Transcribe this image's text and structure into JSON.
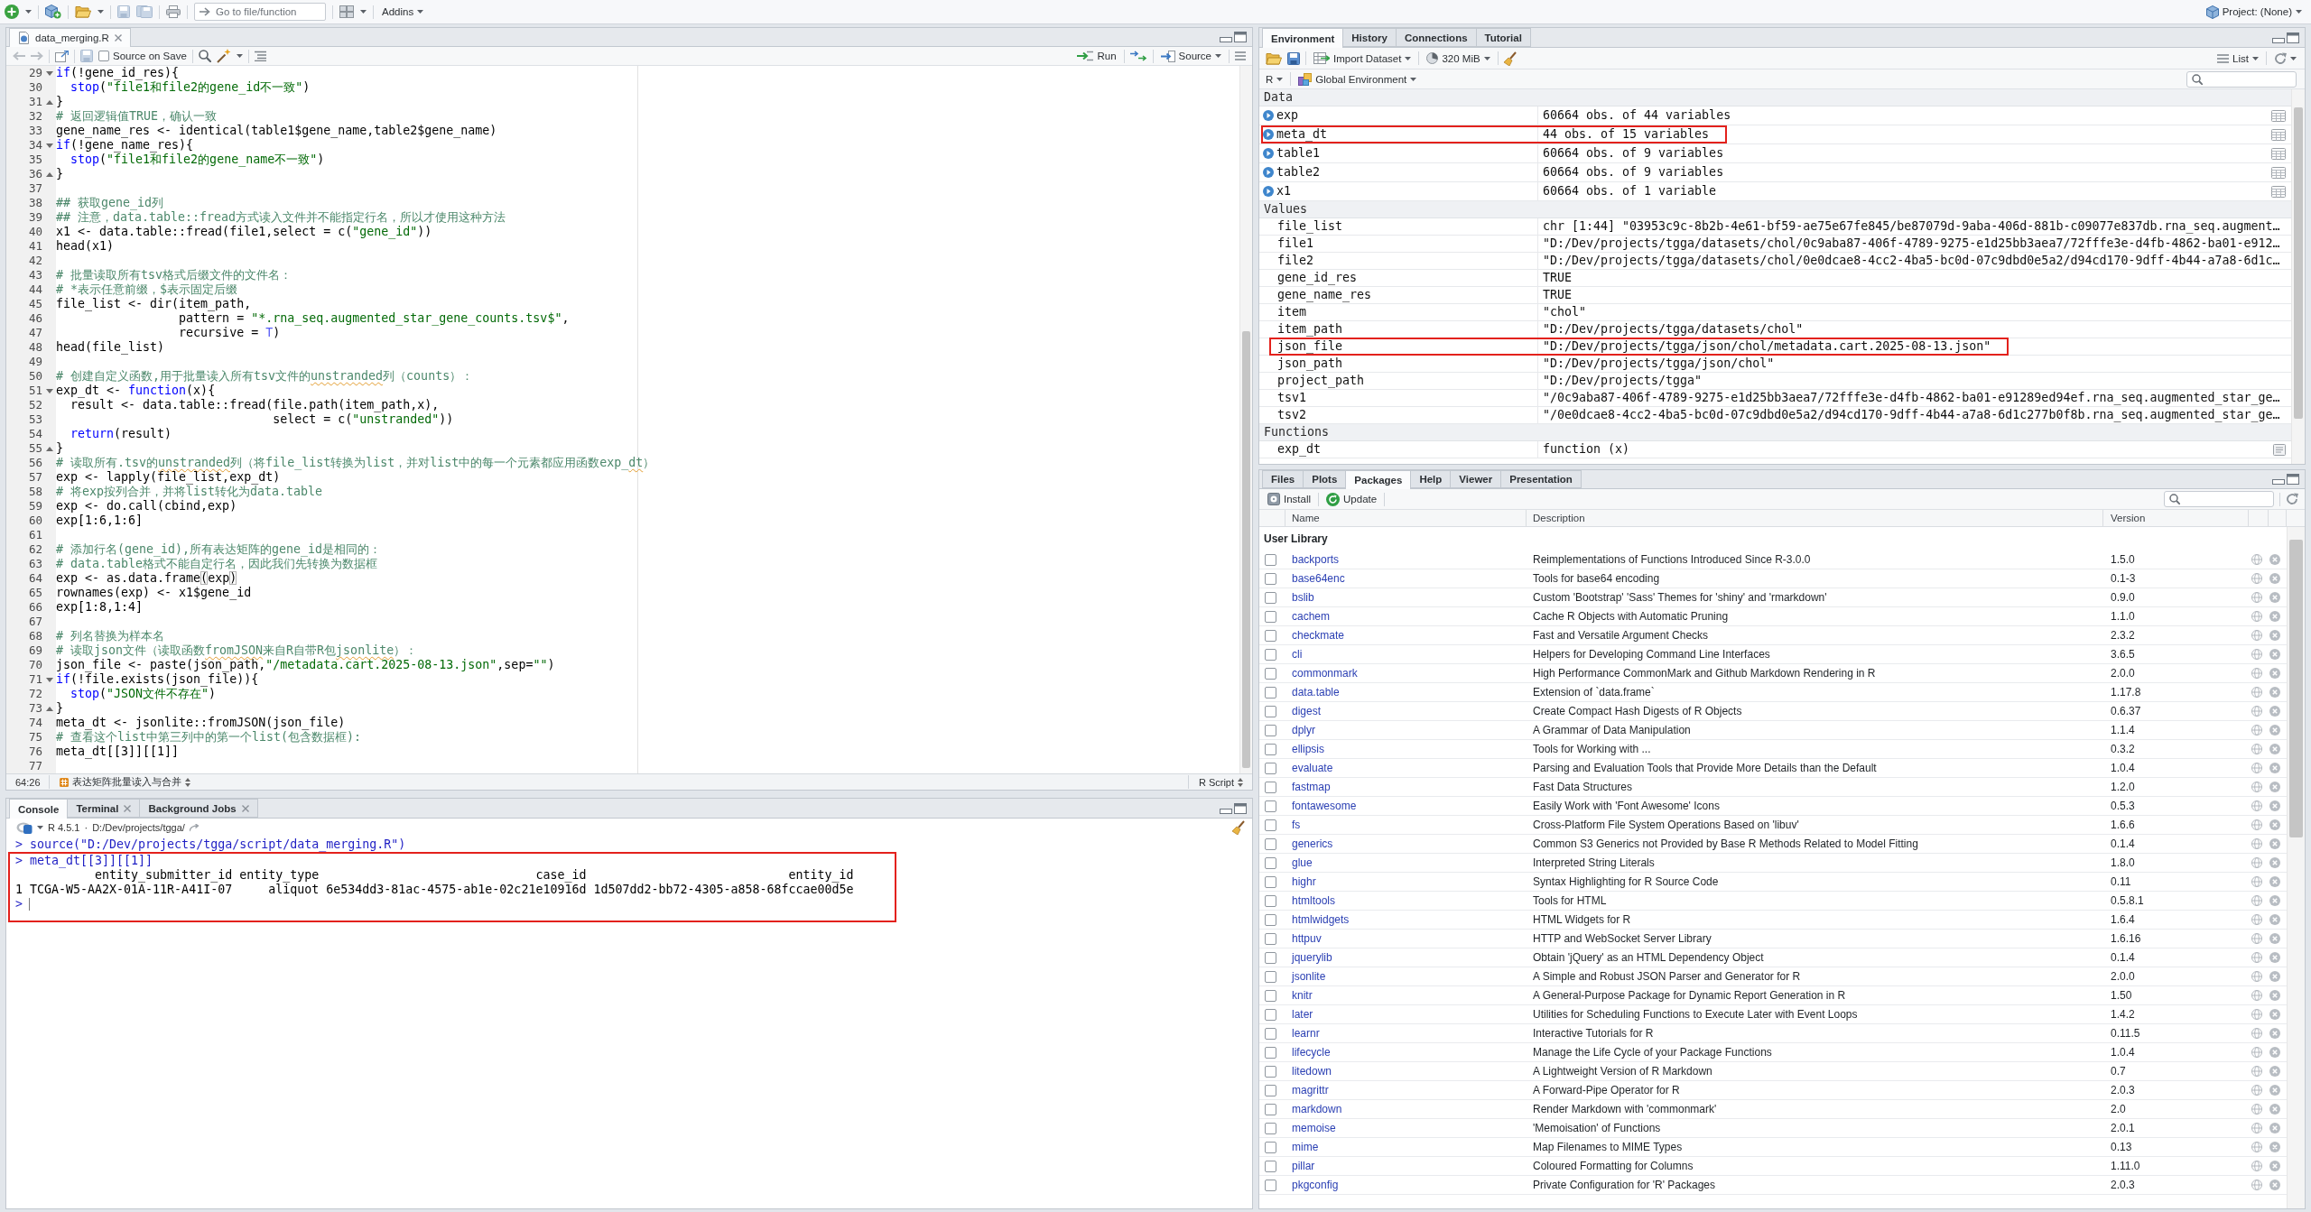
{
  "toolbar": {
    "search": {
      "placeholder": "Go to file/function"
    },
    "addins": "Addins",
    "project": "Project: (None)"
  },
  "editor": {
    "tabs": [
      {
        "label": "data_merging.R",
        "selected": true
      }
    ],
    "source_on_save": {
      "label": "Source on Save",
      "checked": false
    },
    "run": "Run",
    "source": "Source",
    "lines": [
      {
        "n": "29",
        "kind": "fold_start",
        "tokens": [
          {
            "kind": "keyword",
            "text": "if"
          },
          {
            "kind": "plain",
            "text": "(!gene_id_res){"
          }
        ]
      },
      {
        "n": "30",
        "kind": "plain",
        "tokens": [
          {
            "kind": "keyword",
            "text": "  stop"
          },
          {
            "kind": "plain",
            "text": "("
          },
          {
            "kind": "string",
            "text": "\"file1和file2的gene_id不一致\""
          },
          {
            "kind": "plain",
            "text": ")"
          }
        ]
      },
      {
        "n": "31",
        "kind": "fold_end",
        "tokens": [
          {
            "kind": "plain",
            "text": "}"
          }
        ]
      },
      {
        "n": "32",
        "kind": "plain",
        "tokens": [
          {
            "kind": "comment",
            "text": "# 返回逻辑值TRUE，确认一致"
          }
        ]
      },
      {
        "n": "33",
        "kind": "plain",
        "tokens": [
          {
            "kind": "plain",
            "text": "gene_name_res <- identical(table1$gene_name,table2$gene_name)"
          }
        ]
      },
      {
        "n": "34",
        "kind": "fold_start",
        "tokens": [
          {
            "kind": "keyword",
            "text": "if"
          },
          {
            "kind": "plain",
            "text": "(!gene_name_res){"
          }
        ]
      },
      {
        "n": "35",
        "kind": "plain",
        "tokens": [
          {
            "kind": "keyword",
            "text": "  stop"
          },
          {
            "kind": "plain",
            "text": "("
          },
          {
            "kind": "string",
            "text": "\"file1和file2的gene_name不一致\""
          },
          {
            "kind": "plain",
            "text": ")"
          }
        ]
      },
      {
        "n": "36",
        "kind": "fold_end",
        "tokens": [
          {
            "kind": "plain",
            "text": "}"
          }
        ]
      },
      {
        "n": "37",
        "kind": "plain"
      },
      {
        "n": "38",
        "kind": "plain",
        "tokens": [
          {
            "kind": "comment",
            "text": "## 获取gene_id列"
          }
        ]
      },
      {
        "n": "39",
        "kind": "plain",
        "tokens": [
          {
            "kind": "comment",
            "text": "## 注意，data.table::fread方式读入文件并不能指定行名，所以才使用这种方法"
          }
        ]
      },
      {
        "n": "40",
        "kind": "plain",
        "tokens": [
          {
            "kind": "plain",
            "text": "x1 <- data.table::fread(file1,select = c("
          },
          {
            "kind": "string",
            "text": "\"gene_id\""
          },
          {
            "kind": "plain",
            "text": "))"
          }
        ]
      },
      {
        "n": "41",
        "kind": "plain",
        "tokens": [
          {
            "kind": "plain",
            "text": "head(x1)"
          }
        ]
      },
      {
        "n": "42",
        "kind": "plain"
      },
      {
        "n": "43",
        "kind": "plain",
        "tokens": [
          {
            "kind": "comment",
            "text": "# 批量读取所有tsv格式后缀文件的文件名："
          }
        ]
      },
      {
        "n": "44",
        "kind": "plain",
        "tokens": [
          {
            "kind": "comment",
            "text": "# *表示任意前缀，$表示固定后缀"
          }
        ]
      },
      {
        "n": "45",
        "kind": "plain",
        "tokens": [
          {
            "kind": "plain",
            "text": "file_list <- dir(item_path,"
          }
        ]
      },
      {
        "n": "46",
        "kind": "plain",
        "tokens": [
          {
            "kind": "plain",
            "text": "                 pattern = "
          },
          {
            "kind": "string",
            "text": "\"*.rna_seq.augmented_star_gene_counts.tsv$\""
          },
          {
            "kind": "plain",
            "text": ","
          }
        ]
      },
      {
        "n": "47",
        "kind": "plain",
        "tokens": [
          {
            "kind": "plain",
            "text": "                 recursive = "
          },
          {
            "kind": "constant",
            "text": "T"
          },
          {
            "kind": "plain",
            "text": ")"
          }
        ]
      },
      {
        "n": "48",
        "kind": "plain",
        "tokens": [
          {
            "kind": "plain",
            "text": "head(file_list)"
          }
        ]
      },
      {
        "n": "49",
        "kind": "plain"
      },
      {
        "n": "50",
        "kind": "plain",
        "tokens": [
          {
            "kind": "comment",
            "text": "# 创建自定义函数,用于批量读入所有tsv文件的"
          },
          {
            "kind": "flagged",
            "text": "unstranded"
          },
          {
            "kind": "comment",
            "text": "列（counts）："
          }
        ]
      },
      {
        "n": "51",
        "kind": "fold_start",
        "tokens": [
          {
            "kind": "plain",
            "text": "exp_dt <- "
          },
          {
            "kind": "keyword",
            "text": "function"
          },
          {
            "kind": "plain",
            "text": "(x){"
          }
        ]
      },
      {
        "n": "52",
        "kind": "plain",
        "tokens": [
          {
            "kind": "plain",
            "text": "  result <- data.table::fread(file.path(item_path,x),"
          }
        ]
      },
      {
        "n": "53",
        "kind": "plain",
        "tokens": [
          {
            "kind": "plain",
            "text": "                              select = c("
          },
          {
            "kind": "string",
            "text": "\"unstranded\""
          },
          {
            "kind": "plain",
            "text": "))"
          }
        ]
      },
      {
        "n": "54",
        "kind": "plain",
        "tokens": [
          {
            "kind": "keyword",
            "text": "  return"
          },
          {
            "kind": "plain",
            "text": "(result)"
          }
        ]
      },
      {
        "n": "55",
        "kind": "fold_end",
        "tokens": [
          {
            "kind": "plain",
            "text": "}"
          }
        ]
      },
      {
        "n": "56",
        "kind": "plain",
        "tokens": [
          {
            "kind": "comment",
            "text": "# 读取所有.tsv的"
          },
          {
            "kind": "flagged",
            "text": "unstranded"
          },
          {
            "kind": "comment",
            "text": "列（将file_list转换为list，并对list中的每一个元素都应用函数exp_"
          },
          {
            "kind": "flagged",
            "text": "dt"
          },
          {
            "kind": "comment",
            "text": "）"
          }
        ]
      },
      {
        "n": "57",
        "kind": "plain",
        "tokens": [
          {
            "kind": "plain",
            "text": "exp <- lapply(file_list,exp_dt)"
          }
        ]
      },
      {
        "n": "58",
        "kind": "plain",
        "tokens": [
          {
            "kind": "comment",
            "text": "# 将exp按列合并，并将list转化为data.table"
          }
        ]
      },
      {
        "n": "59",
        "kind": "plain",
        "tokens": [
          {
            "kind": "plain",
            "text": "exp <- do.call(cbind,exp)"
          }
        ]
      },
      {
        "n": "60",
        "kind": "plain",
        "tokens": [
          {
            "kind": "plain",
            "text": "exp[1:6,1:6]"
          }
        ]
      },
      {
        "n": "61",
        "kind": "plain"
      },
      {
        "n": "62",
        "kind": "plain",
        "tokens": [
          {
            "kind": "comment",
            "text": "# 添加行名(gene_id),所有表达矩阵的gene_id是相同的："
          }
        ]
      },
      {
        "n": "63",
        "kind": "plain",
        "tokens": [
          {
            "kind": "comment",
            "text": "# data.table格式不能自定行名，因此我们先转换为数据框"
          }
        ]
      },
      {
        "n": "64",
        "kind": "plain",
        "tokens": [
          {
            "kind": "plain",
            "text": "exp <- as.data.frame"
          },
          {
            "kind": "bracket",
            "text": "("
          },
          {
            "kind": "plain",
            "text": "exp"
          },
          {
            "kind": "bracket",
            "text": ")"
          }
        ]
      },
      {
        "n": "65",
        "kind": "plain",
        "tokens": [
          {
            "kind": "plain",
            "text": "rownames(exp) <- x1$gene_id"
          }
        ]
      },
      {
        "n": "66",
        "kind": "plain",
        "tokens": [
          {
            "kind": "plain",
            "text": "exp[1:8,1:4]"
          }
        ]
      },
      {
        "n": "67",
        "kind": "plain"
      },
      {
        "n": "68",
        "kind": "plain",
        "tokens": [
          {
            "kind": "comment",
            "text": "# 列名替换为样本名"
          }
        ]
      },
      {
        "n": "69",
        "kind": "plain",
        "tokens": [
          {
            "kind": "comment",
            "text": "# 读取json文件（读取函数"
          },
          {
            "kind": "flagged",
            "text": "fromJSON"
          },
          {
            "kind": "comment",
            "text": "来自R自带R包"
          },
          {
            "kind": "flagged",
            "text": "jsonlite"
          },
          {
            "kind": "comment",
            "text": "）："
          }
        ]
      },
      {
        "n": "70",
        "kind": "plain",
        "tokens": [
          {
            "kind": "plain",
            "text": "json_file <- paste(json_path,"
          },
          {
            "kind": "string",
            "text": "\"/metadata.cart.2025-08-13.json\""
          },
          {
            "kind": "plain",
            "text": ",sep="
          },
          {
            "kind": "string",
            "text": "\"\""
          },
          {
            "kind": "plain",
            "text": ")"
          }
        ]
      },
      {
        "n": "71",
        "kind": "fold_start",
        "tokens": [
          {
            "kind": "keyword",
            "text": "if"
          },
          {
            "kind": "plain",
            "text": "(!file.exists(json_file)){"
          }
        ]
      },
      {
        "n": "72",
        "kind": "plain",
        "tokens": [
          {
            "kind": "keyword",
            "text": "  stop"
          },
          {
            "kind": "plain",
            "text": "("
          },
          {
            "kind": "string",
            "text": "\"JSON文件不存在\""
          },
          {
            "kind": "plain",
            "text": ")"
          }
        ]
      },
      {
        "n": "73",
        "kind": "fold_end",
        "tokens": [
          {
            "kind": "plain",
            "text": "}"
          }
        ]
      },
      {
        "n": "74",
        "kind": "plain",
        "tokens": [
          {
            "kind": "plain",
            "text": "meta_dt <- jsonlite::fromJSON(json_file)"
          }
        ]
      },
      {
        "n": "75",
        "kind": "plain",
        "tokens": [
          {
            "kind": "comment",
            "text": "# 查看这个list中第三列中的第一个list(包含数据框):"
          }
        ]
      },
      {
        "n": "76",
        "kind": "plain",
        "tokens": [
          {
            "kind": "plain",
            "text": "meta_dt[[3]][[1]]"
          }
        ]
      },
      {
        "n": "77",
        "kind": "plain"
      }
    ],
    "status": {
      "position": "64:26",
      "section": "表达矩阵批量读入与合并",
      "file_type": "R Script"
    }
  },
  "console": {
    "tabs": [
      {
        "label": "Console",
        "selected": true,
        "closable": false
      },
      {
        "label": "Terminal",
        "selected": false,
        "closable": true
      },
      {
        "label": "Background Jobs",
        "selected": false,
        "closable": true
      }
    ],
    "version": "R 4.5.1",
    "separator": "·",
    "path": "D:/Dev/projects/tgga/",
    "blocks": [
      {
        "annotated": false,
        "lines": [
          {
            "kind": "input",
            "text": "> source(\"D:/Dev/projects/tgga/script/data_merging.R\")"
          }
        ]
      },
      {
        "annotated": true,
        "lines": [
          {
            "kind": "input",
            "text": "> meta_dt[[3]][[1]]"
          },
          {
            "kind": "output",
            "text": "           entity_submitter_id entity_type                              case_id                            entity_id"
          },
          {
            "kind": "output",
            "text": "1 TCGA-W5-AA2X-01A-11R-A41I-07     aliquot 6e534dd3-81ac-4575-ab1e-02c21e10916d 1d507dd2-bb72-4305-a858-68fccae00d5e"
          },
          {
            "kind": "prompt",
            "text": ">"
          }
        ]
      }
    ]
  },
  "environment": {
    "tabs": [
      {
        "label": "Environment",
        "selected": true
      },
      {
        "label": "History",
        "selected": false
      },
      {
        "label": "Connections",
        "selected": false
      },
      {
        "label": "Tutorial",
        "selected": false
      }
    ],
    "import": "Import Dataset",
    "memory": "320 MiB",
    "view": "List",
    "language": "R",
    "scope": "Global Environment",
    "sections": [
      {
        "kind": "data",
        "title": "Data",
        "rows": [
          {
            "name": "exp",
            "value": "60664 obs. of 44 variables",
            "annotated": false
          },
          {
            "name": "meta_dt",
            "value": "44 obs. of 15 variables",
            "annotated": true
          },
          {
            "name": "table1",
            "value": "60664 obs. of 9 variables",
            "annotated": false
          },
          {
            "name": "table2",
            "value": "60664 obs. of 9 variables",
            "annotated": false
          },
          {
            "name": "x1",
            "value": "60664 obs. of 1 variable",
            "annotated": false
          }
        ]
      },
      {
        "kind": "values",
        "title": "Values",
        "rows": [
          {
            "name": "file_list",
            "value": "chr [1:44] \"03953c9c-8b2b-4e61-bf59-ae75e67fe845/be87079d-9aba-406d-881b-c09077e837db.rna_seq.augment…",
            "annotated": false
          },
          {
            "name": "file1",
            "value": "\"D:/Dev/projects/tgga/datasets/chol/0c9aba87-406f-4789-9275-e1d25bb3aea7/72fffe3e-d4fb-4862-ba01-e912…",
            "annotated": false
          },
          {
            "name": "file2",
            "value": "\"D:/Dev/projects/tgga/datasets/chol/0e0dcae8-4cc2-4ba5-bc0d-07c9dbd0e5a2/d94cd170-9dff-4b44-a7a8-6d1c…",
            "annotated": false
          },
          {
            "name": "gene_id_res",
            "value": "TRUE",
            "annotated": false
          },
          {
            "name": "gene_name_res",
            "value": "TRUE",
            "annotated": false
          },
          {
            "name": "item",
            "value": "\"chol\"",
            "annotated": false
          },
          {
            "name": "item_path",
            "value": "\"D:/Dev/projects/tgga/datasets/chol\"",
            "annotated": false
          },
          {
            "name": "json_file",
            "value": "\"D:/Dev/projects/tgga/json/chol/metadata.cart.2025-08-13.json\"",
            "annotated": true
          },
          {
            "name": "json_path",
            "value": "\"D:/Dev/projects/tgga/json/chol\"",
            "annotated": false
          },
          {
            "name": "project_path",
            "value": "\"D:/Dev/projects/tgga\"",
            "annotated": false
          },
          {
            "name": "tsv1",
            "value": "\"/0c9aba87-406f-4789-9275-e1d25bb3aea7/72fffe3e-d4fb-4862-ba01-e91289ed94ef.rna_seq.augmented_star_ge…",
            "annotated": false
          },
          {
            "name": "tsv2",
            "value": "\"/0e0dcae8-4cc2-4ba5-bc0d-07c9dbd0e5a2/d94cd170-9dff-4b44-a7a8-6d1c277b0f8b.rna_seq.augmented_star_ge…",
            "annotated": false
          }
        ]
      },
      {
        "kind": "functions",
        "title": "Functions",
        "rows": [
          {
            "name": "exp_dt",
            "value": "function (x)",
            "annotated": false
          }
        ]
      }
    ]
  },
  "packages": {
    "tabs": [
      {
        "label": "Files",
        "selected": false
      },
      {
        "label": "Plots",
        "selected": false
      },
      {
        "label": "Packages",
        "selected": true
      },
      {
        "label": "Help",
        "selected": false
      },
      {
        "label": "Viewer",
        "selected": false
      },
      {
        "label": "Presentation",
        "selected": false
      }
    ],
    "install": "Install",
    "update": "Update",
    "columns": [
      "Name",
      "Description",
      "Version"
    ],
    "library": "User Library",
    "rows": [
      {
        "name": "backports",
        "description": "Reimplementations of Functions Introduced Since R-3.0.0",
        "version": "1.5.0",
        "checked": false
      },
      {
        "name": "base64enc",
        "description": "Tools for base64 encoding",
        "version": "0.1-3",
        "checked": false
      },
      {
        "name": "bslib",
        "description": "Custom 'Bootstrap' 'Sass' Themes for 'shiny' and 'rmarkdown'",
        "version": "0.9.0",
        "checked": false
      },
      {
        "name": "cachem",
        "description": "Cache R Objects with Automatic Pruning",
        "version": "1.1.0",
        "checked": false
      },
      {
        "name": "checkmate",
        "description": "Fast and Versatile Argument Checks",
        "version": "2.3.2",
        "checked": false
      },
      {
        "name": "cli",
        "description": "Helpers for Developing Command Line Interfaces",
        "version": "3.6.5",
        "checked": false
      },
      {
        "name": "commonmark",
        "description": "High Performance CommonMark and Github Markdown Rendering in R",
        "version": "2.0.0",
        "checked": false
      },
      {
        "name": "data.table",
        "description": "Extension of `data.frame`",
        "version": "1.17.8",
        "checked": false
      },
      {
        "name": "digest",
        "description": "Create Compact Hash Digests of R Objects",
        "version": "0.6.37",
        "checked": false
      },
      {
        "name": "dplyr",
        "description": "A Grammar of Data Manipulation",
        "version": "1.1.4",
        "checked": false
      },
      {
        "name": "ellipsis",
        "description": "Tools for Working with ...",
        "version": "0.3.2",
        "checked": false
      },
      {
        "name": "evaluate",
        "description": "Parsing and Evaluation Tools that Provide More Details than the Default",
        "version": "1.0.4",
        "checked": false
      },
      {
        "name": "fastmap",
        "description": "Fast Data Structures",
        "version": "1.2.0",
        "checked": false
      },
      {
        "name": "fontawesome",
        "description": "Easily Work with 'Font Awesome' Icons",
        "version": "0.5.3",
        "checked": false
      },
      {
        "name": "fs",
        "description": "Cross-Platform File System Operations Based on 'libuv'",
        "version": "1.6.6",
        "checked": false
      },
      {
        "name": "generics",
        "description": "Common S3 Generics not Provided by Base R Methods Related to Model Fitting",
        "version": "0.1.4",
        "checked": false
      },
      {
        "name": "glue",
        "description": "Interpreted String Literals",
        "version": "1.8.0",
        "checked": false
      },
      {
        "name": "highr",
        "description": "Syntax Highlighting for R Source Code",
        "version": "0.11",
        "checked": false
      },
      {
        "name": "htmltools",
        "description": "Tools for HTML",
        "version": "0.5.8.1",
        "checked": false
      },
      {
        "name": "htmlwidgets",
        "description": "HTML Widgets for R",
        "version": "1.6.4",
        "checked": false
      },
      {
        "name": "httpuv",
        "description": "HTTP and WebSocket Server Library",
        "version": "1.6.16",
        "checked": false
      },
      {
        "name": "jquerylib",
        "description": "Obtain 'jQuery' as an HTML Dependency Object",
        "version": "0.1.4",
        "checked": false
      },
      {
        "name": "jsonlite",
        "description": "A Simple and Robust JSON Parser and Generator for R",
        "version": "2.0.0",
        "checked": false
      },
      {
        "name": "knitr",
        "description": "A General-Purpose Package for Dynamic Report Generation in R",
        "version": "1.50",
        "checked": false
      },
      {
        "name": "later",
        "description": "Utilities for Scheduling Functions to Execute Later with Event Loops",
        "version": "1.4.2",
        "checked": false
      },
      {
        "name": "learnr",
        "description": "Interactive Tutorials for R",
        "version": "0.11.5",
        "checked": false
      },
      {
        "name": "lifecycle",
        "description": "Manage the Life Cycle of your Package Functions",
        "version": "1.0.4",
        "checked": false
      },
      {
        "name": "litedown",
        "description": "A Lightweight Version of R Markdown",
        "version": "0.7",
        "checked": false
      },
      {
        "name": "magrittr",
        "description": "A Forward-Pipe Operator for R",
        "version": "2.0.3",
        "checked": false
      },
      {
        "name": "markdown",
        "description": "Render Markdown with 'commonmark'",
        "version": "2.0",
        "checked": false
      },
      {
        "name": "memoise",
        "description": "'Memoisation' of Functions",
        "version": "2.0.1",
        "checked": false
      },
      {
        "name": "mime",
        "description": "Map Filenames to MIME Types",
        "version": "0.13",
        "checked": false
      },
      {
        "name": "pillar",
        "description": "Coloured Formatting for Columns",
        "version": "1.11.0",
        "checked": false
      },
      {
        "name": "pkgconfig",
        "description": "Private Configuration for 'R' Packages",
        "version": "2.0.3",
        "checked": false
      }
    ]
  }
}
